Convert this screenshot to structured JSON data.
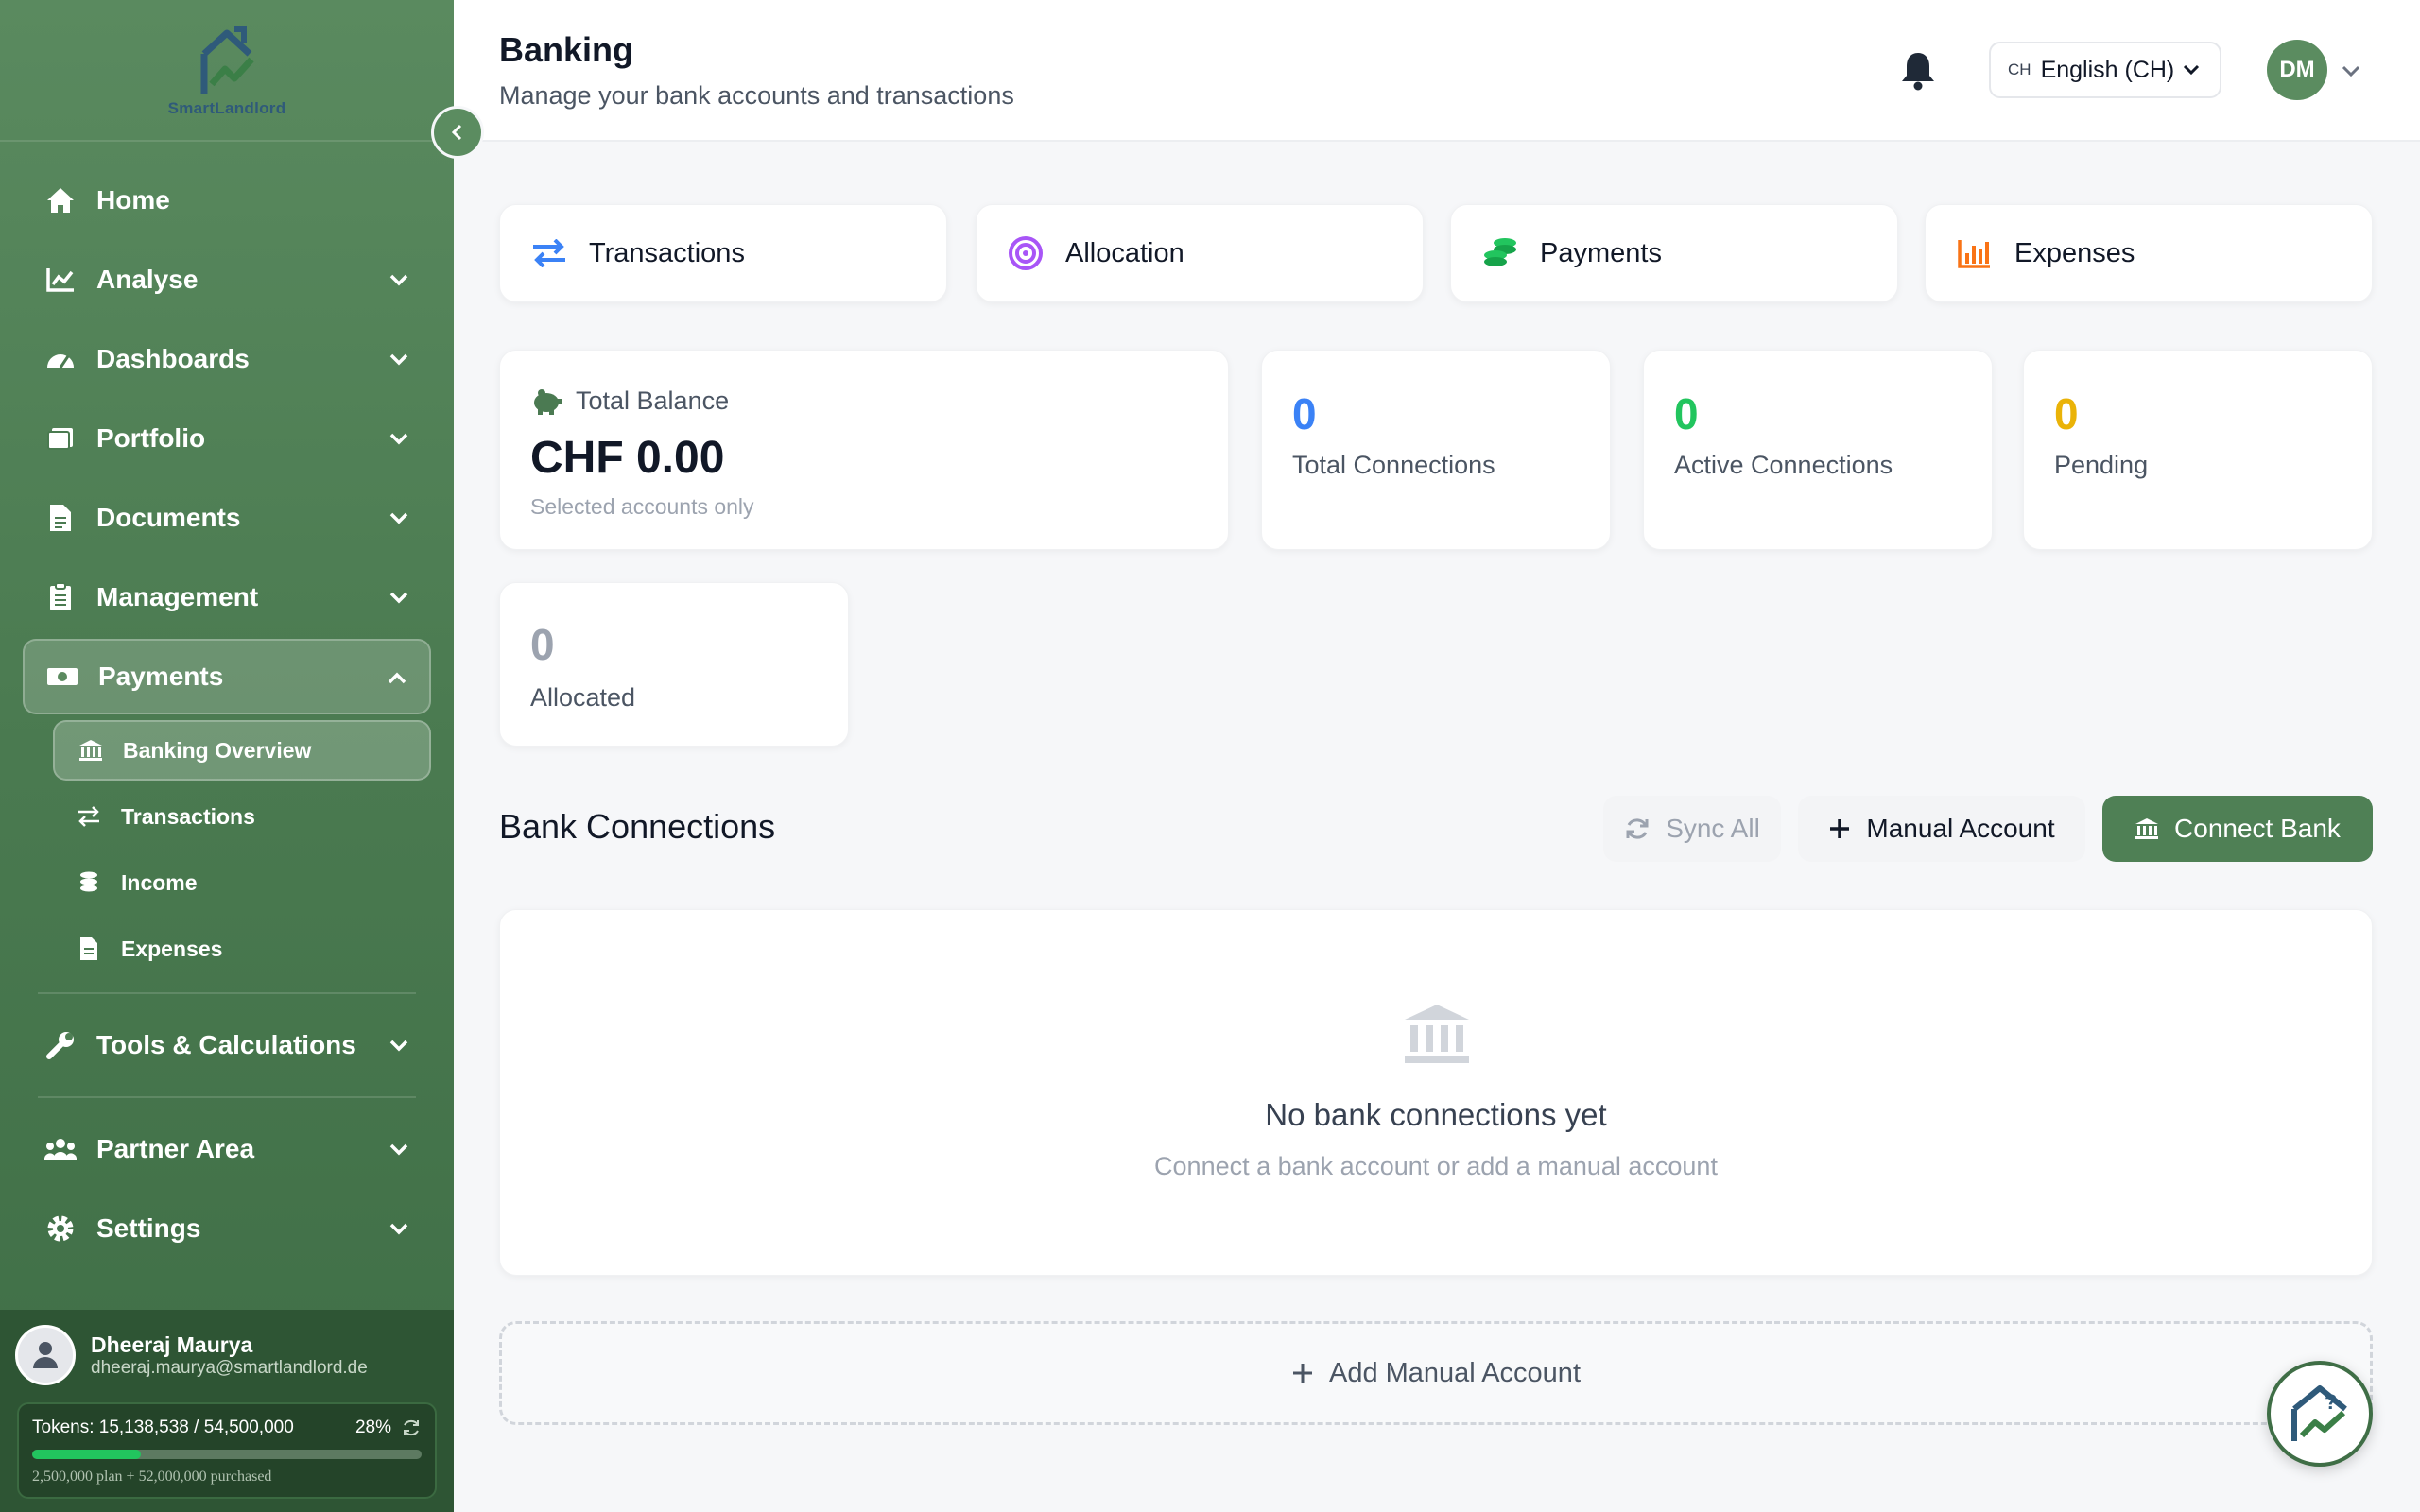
{
  "brand": {
    "name": "SmartLandlord",
    "accent": "#5b8c60",
    "sidebar_bg": "#4a7a50"
  },
  "sidebar": {
    "items": [
      {
        "label": "Home",
        "icon": "home-icon"
      },
      {
        "label": "Analyse",
        "icon": "chart-line-icon"
      },
      {
        "label": "Dashboards",
        "icon": "gauge-icon"
      },
      {
        "label": "Portfolio",
        "icon": "portfolio-icon"
      },
      {
        "label": "Documents",
        "icon": "document-icon"
      },
      {
        "label": "Management",
        "icon": "clipboard-icon"
      },
      {
        "label": "Payments",
        "icon": "money-icon"
      }
    ],
    "sub_items": [
      {
        "label": "Banking Overview",
        "icon": "bank-icon"
      },
      {
        "label": "Transactions",
        "icon": "arrows-exchange-icon"
      },
      {
        "label": "Income",
        "icon": "coins-icon"
      },
      {
        "label": "Expenses",
        "icon": "file-invoice-icon"
      }
    ],
    "bottom_items": [
      {
        "label": "Tools & Calculations",
        "icon": "wrench-icon"
      },
      {
        "label": "Partner Area",
        "icon": "users-icon"
      },
      {
        "label": "Settings",
        "icon": "gear-icon"
      }
    ]
  },
  "user": {
    "name": "Dheeraj Maurya",
    "email": "dheeraj.maurya@smartlandlord.de",
    "tokens_label": "Tokens: 15,138,538 / 54,500,000",
    "tokens_percent": "28%",
    "tokens_fraction": 0.28,
    "tokens_sub": "2,500,000 plan + 52,000,000 purchased"
  },
  "header": {
    "title": "Banking",
    "subtitle": "Manage your bank accounts and transactions",
    "lang_code": "CH",
    "lang_label": "English (CH)",
    "avatar_initials": "DM"
  },
  "tabs": [
    {
      "label": "Transactions",
      "icon": "arrows-exchange-icon",
      "color": "#3b82f6"
    },
    {
      "label": "Allocation",
      "icon": "target-icon",
      "color": "#a855f7"
    },
    {
      "label": "Payments",
      "icon": "coins-icon",
      "color": "#22c55e"
    },
    {
      "label": "Expenses",
      "icon": "bar-chart-icon",
      "color": "#f97316"
    }
  ],
  "balance": {
    "label": "Total Balance",
    "value": "CHF 0.00",
    "note": "Selected accounts only"
  },
  "stats": [
    {
      "value": "0",
      "label": "Total Connections",
      "color": "#3b82f6"
    },
    {
      "value": "0",
      "label": "Active Connections",
      "color": "#22c55e"
    },
    {
      "value": "0",
      "label": "Pending",
      "color": "#eab308"
    },
    {
      "value": "0",
      "label": "Allocated",
      "color": "#9ca3af"
    }
  ],
  "connections": {
    "title": "Bank Connections",
    "sync_label": "Sync All",
    "manual_label": "Manual Account",
    "connect_label": "Connect Bank",
    "empty_title": "No bank connections yet",
    "empty_sub": "Connect a bank account or add a manual account",
    "add_manual_label": "Add Manual Account"
  }
}
